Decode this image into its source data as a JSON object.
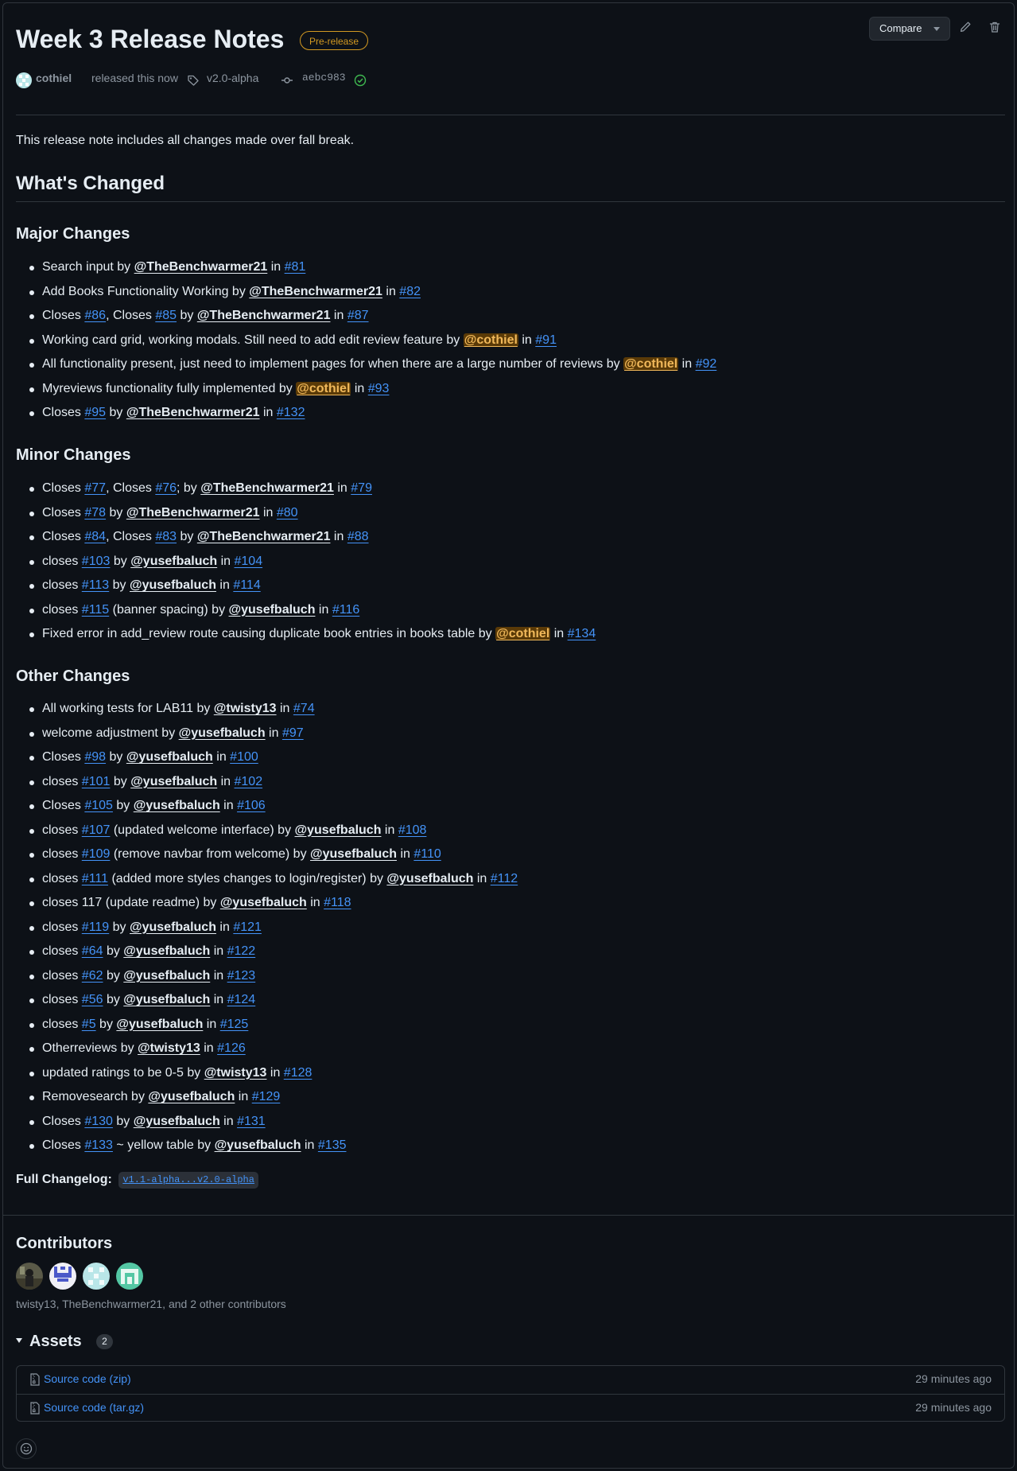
{
  "release": {
    "title": "Week 3 Release Notes",
    "badge": "Pre-release",
    "author": "cothiel",
    "released_text": "released this now",
    "tag": "v2.0-alpha",
    "commit": "aebc983",
    "compare_label": "Compare"
  },
  "body": {
    "intro": "This release note includes all changes made over fall break.",
    "heading": "What's Changed",
    "sections": [
      {
        "title": "Major Changes",
        "items": [
          [
            {
              "t": "Search input by "
            },
            {
              "u": "@TheBenchwarmer21"
            },
            {
              "t": " in "
            },
            {
              "l": "#81"
            }
          ],
          [
            {
              "t": "Add Books Functionality Working by "
            },
            {
              "u": "@TheBenchwarmer21"
            },
            {
              "t": " in "
            },
            {
              "l": "#82"
            }
          ],
          [
            {
              "t": "Closes "
            },
            {
              "l": "#86"
            },
            {
              "t": ", Closes "
            },
            {
              "l": "#85"
            },
            {
              "t": " by "
            },
            {
              "u": "@TheBenchwarmer21"
            },
            {
              "t": " in "
            },
            {
              "l": "#87"
            }
          ],
          [
            {
              "t": "Working card grid, working modals. Still need to add edit review feature by "
            },
            {
              "u": "@cothiel",
              "hl": true
            },
            {
              "t": " in "
            },
            {
              "l": "#91"
            }
          ],
          [
            {
              "t": "All functionality present, just need to implement pages for when there are a large number of reviews by "
            },
            {
              "u": "@cothiel",
              "hl": true
            },
            {
              "t": " in "
            },
            {
              "l": "#92"
            }
          ],
          [
            {
              "t": "Myreviews functionality fully implemented by "
            },
            {
              "u": "@cothiel",
              "hl": true
            },
            {
              "t": " in "
            },
            {
              "l": "#93"
            }
          ],
          [
            {
              "t": "Closes "
            },
            {
              "l": "#95"
            },
            {
              "t": " by "
            },
            {
              "u": "@TheBenchwarmer21"
            },
            {
              "t": " in "
            },
            {
              "l": "#132"
            }
          ]
        ]
      },
      {
        "title": "Minor Changes",
        "items": [
          [
            {
              "t": "Closes "
            },
            {
              "l": "#77"
            },
            {
              "t": ", Closes "
            },
            {
              "l": "#76"
            },
            {
              "t": "; by "
            },
            {
              "u": "@TheBenchwarmer21"
            },
            {
              "t": " in "
            },
            {
              "l": "#79"
            }
          ],
          [
            {
              "t": "Closes "
            },
            {
              "l": "#78"
            },
            {
              "t": " by "
            },
            {
              "u": "@TheBenchwarmer21"
            },
            {
              "t": " in "
            },
            {
              "l": "#80"
            }
          ],
          [
            {
              "t": "Closes "
            },
            {
              "l": "#84"
            },
            {
              "t": ", Closes "
            },
            {
              "l": "#83"
            },
            {
              "t": " by "
            },
            {
              "u": "@TheBenchwarmer21"
            },
            {
              "t": " in "
            },
            {
              "l": "#88"
            }
          ],
          [
            {
              "t": "closes "
            },
            {
              "l": "#103"
            },
            {
              "t": " by "
            },
            {
              "u": "@yusefbaluch"
            },
            {
              "t": " in "
            },
            {
              "l": "#104"
            }
          ],
          [
            {
              "t": "closes "
            },
            {
              "l": "#113"
            },
            {
              "t": " by "
            },
            {
              "u": "@yusefbaluch"
            },
            {
              "t": " in "
            },
            {
              "l": "#114"
            }
          ],
          [
            {
              "t": "closes "
            },
            {
              "l": "#115"
            },
            {
              "t": " (banner spacing) by "
            },
            {
              "u": "@yusefbaluch"
            },
            {
              "t": " in "
            },
            {
              "l": "#116"
            }
          ],
          [
            {
              "t": "Fixed error in add_review route causing duplicate book entries in books table by "
            },
            {
              "u": "@cothiel",
              "hl": true
            },
            {
              "t": " in "
            },
            {
              "l": "#134"
            }
          ]
        ]
      },
      {
        "title": "Other Changes",
        "items": [
          [
            {
              "t": "All working tests for LAB11 by "
            },
            {
              "u": "@twisty13"
            },
            {
              "t": " in "
            },
            {
              "l": "#74"
            }
          ],
          [
            {
              "t": "welcome adjustment by "
            },
            {
              "u": "@yusefbaluch"
            },
            {
              "t": " in "
            },
            {
              "l": "#97"
            }
          ],
          [
            {
              "t": "Closes "
            },
            {
              "l": "#98"
            },
            {
              "t": " by "
            },
            {
              "u": "@yusefbaluch"
            },
            {
              "t": " in "
            },
            {
              "l": "#100"
            }
          ],
          [
            {
              "t": "closes "
            },
            {
              "l": "#101"
            },
            {
              "t": " by "
            },
            {
              "u": "@yusefbaluch"
            },
            {
              "t": " in "
            },
            {
              "l": "#102"
            }
          ],
          [
            {
              "t": "Closes "
            },
            {
              "l": "#105"
            },
            {
              "t": " by "
            },
            {
              "u": "@yusefbaluch"
            },
            {
              "t": " in "
            },
            {
              "l": "#106"
            }
          ],
          [
            {
              "t": "closes "
            },
            {
              "l": "#107"
            },
            {
              "t": " (updated welcome interface) by "
            },
            {
              "u": "@yusefbaluch"
            },
            {
              "t": " in "
            },
            {
              "l": "#108"
            }
          ],
          [
            {
              "t": "closes "
            },
            {
              "l": "#109"
            },
            {
              "t": " (remove navbar from welcome) by "
            },
            {
              "u": "@yusefbaluch"
            },
            {
              "t": " in "
            },
            {
              "l": "#110"
            }
          ],
          [
            {
              "t": "closes "
            },
            {
              "l": "#111"
            },
            {
              "t": " (added more styles changes to login/register) by "
            },
            {
              "u": "@yusefbaluch"
            },
            {
              "t": " in "
            },
            {
              "l": "#112"
            }
          ],
          [
            {
              "t": "closes 117 (update readme) by "
            },
            {
              "u": "@yusefbaluch"
            },
            {
              "t": " in "
            },
            {
              "l": "#118"
            }
          ],
          [
            {
              "t": "closes "
            },
            {
              "l": "#119"
            },
            {
              "t": " by "
            },
            {
              "u": "@yusefbaluch"
            },
            {
              "t": " in "
            },
            {
              "l": "#121"
            }
          ],
          [
            {
              "t": "closes "
            },
            {
              "l": "#64"
            },
            {
              "t": " by "
            },
            {
              "u": "@yusefbaluch"
            },
            {
              "t": " in "
            },
            {
              "l": "#122"
            }
          ],
          [
            {
              "t": "closes "
            },
            {
              "l": "#62"
            },
            {
              "t": " by "
            },
            {
              "u": "@yusefbaluch"
            },
            {
              "t": " in "
            },
            {
              "l": "#123"
            }
          ],
          [
            {
              "t": "closes "
            },
            {
              "l": "#56"
            },
            {
              "t": " by "
            },
            {
              "u": "@yusefbaluch"
            },
            {
              "t": " in "
            },
            {
              "l": "#124"
            }
          ],
          [
            {
              "t": "closes "
            },
            {
              "l": "#5"
            },
            {
              "t": " by "
            },
            {
              "u": "@yusefbaluch"
            },
            {
              "t": " in "
            },
            {
              "l": "#125"
            }
          ],
          [
            {
              "t": "Otherreviews by "
            },
            {
              "u": "@twisty13"
            },
            {
              "t": " in "
            },
            {
              "l": "#126"
            }
          ],
          [
            {
              "t": "updated ratings to be 0-5 by "
            },
            {
              "u": "@twisty13"
            },
            {
              "t": " in "
            },
            {
              "l": "#128"
            }
          ],
          [
            {
              "t": "Removesearch by "
            },
            {
              "u": "@yusefbaluch"
            },
            {
              "t": " in "
            },
            {
              "l": "#129"
            }
          ],
          [
            {
              "t": "Closes "
            },
            {
              "l": "#130"
            },
            {
              "t": " by "
            },
            {
              "u": "@yusefbaluch"
            },
            {
              "t": " in "
            },
            {
              "l": "#131"
            }
          ],
          [
            {
              "t": "Closes "
            },
            {
              "l": "#133"
            },
            {
              "t": " ~ yellow table by "
            },
            {
              "u": "@yusefbaluch"
            },
            {
              "t": " in "
            },
            {
              "l": "#135"
            }
          ]
        ]
      }
    ],
    "changelog_label": "Full Changelog",
    "changelog_link": "v1.1-alpha...v2.0-alpha"
  },
  "contributors": {
    "title": "Contributors",
    "summary": "twisty13, TheBenchwarmer21, and 2 other contributors"
  },
  "assets": {
    "title": "Assets",
    "count": "2",
    "files": [
      {
        "name": "Source code (zip)",
        "time": "29 minutes ago"
      },
      {
        "name": "Source code (tar.gz)",
        "time": "29 minutes ago"
      }
    ]
  },
  "colors": {
    "background": "#0d1117",
    "border": "#30363d",
    "link": "#4493f8",
    "prerelease": "#d29922",
    "mention_highlight": "#5a3a07",
    "verified": "#3fb950"
  },
  "icons": [
    "tag-icon",
    "commit-icon",
    "verified-check-icon",
    "pencil-icon",
    "trash-icon",
    "file-zip-icon",
    "smiley-icon",
    "triangle-down-icon"
  ]
}
